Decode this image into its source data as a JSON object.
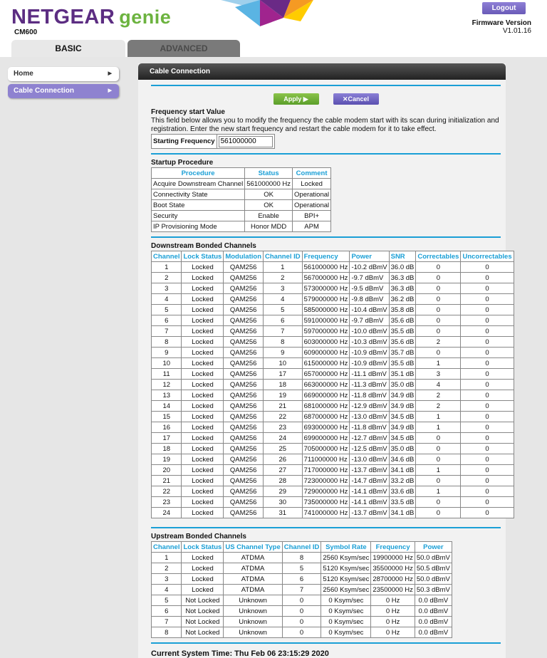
{
  "header": {
    "brand": "NETGEAR",
    "brand_suffix": "genie",
    "model": "CM600",
    "logout": "Logout",
    "firmware_label": "Firmware Version",
    "firmware_value": "V1.01.16"
  },
  "tabs": [
    {
      "label": "BASIC",
      "active": true
    },
    {
      "label": "ADVANCED",
      "active": false
    }
  ],
  "sidebar": {
    "items": [
      {
        "label": "Home"
      },
      {
        "label": "Cable Connection",
        "active": true
      }
    ]
  },
  "panel": {
    "title": "Cable Connection",
    "apply": "Apply ▶",
    "cancel": "✕Cancel"
  },
  "freq": {
    "title": "Frequency start Value",
    "desc": "This field below allows you to modify the frequency the cable modem start with its scan during initialization and registration. Enter the new start frequency and restart the cable modem for it to take effect.",
    "label": "Starting Frequency",
    "value": "561000000"
  },
  "startup": {
    "title": "Startup Procedure",
    "headers": [
      "Procedure",
      "Status",
      "Comment"
    ],
    "rows": [
      [
        "Acquire Downstream Channel",
        "561000000 Hz",
        "Locked"
      ],
      [
        "Connectivity State",
        "OK",
        "Operational"
      ],
      [
        "Boot State",
        "OK",
        "Operational"
      ],
      [
        "Security",
        "Enable",
        "BPI+"
      ],
      [
        "IP Provisioning Mode",
        "Honor MDD",
        "APM"
      ]
    ]
  },
  "downstream": {
    "title": "Downstream Bonded Channels",
    "headers": [
      "Channel",
      "Lock Status",
      "Modulation",
      "Channel ID",
      "Frequency",
      "Power",
      "SNR",
      "Correctables",
      "Uncorrectables"
    ],
    "rows": [
      [
        "1",
        "Locked",
        "QAM256",
        "1",
        "561000000 Hz",
        "-10.2 dBmV",
        "36.0 dB",
        "0",
        "0"
      ],
      [
        "2",
        "Locked",
        "QAM256",
        "2",
        "567000000 Hz",
        "-9.7 dBmV",
        "36.3 dB",
        "0",
        "0"
      ],
      [
        "3",
        "Locked",
        "QAM256",
        "3",
        "573000000 Hz",
        "-9.5 dBmV",
        "36.3 dB",
        "0",
        "0"
      ],
      [
        "4",
        "Locked",
        "QAM256",
        "4",
        "579000000 Hz",
        "-9.8 dBmV",
        "36.2 dB",
        "0",
        "0"
      ],
      [
        "5",
        "Locked",
        "QAM256",
        "5",
        "585000000 Hz",
        "-10.4 dBmV",
        "35.8 dB",
        "0",
        "0"
      ],
      [
        "6",
        "Locked",
        "QAM256",
        "6",
        "591000000 Hz",
        "-9.7 dBmV",
        "35.6 dB",
        "0",
        "0"
      ],
      [
        "7",
        "Locked",
        "QAM256",
        "7",
        "597000000 Hz",
        "-10.0 dBmV",
        "35.5 dB",
        "0",
        "0"
      ],
      [
        "8",
        "Locked",
        "QAM256",
        "8",
        "603000000 Hz",
        "-10.3 dBmV",
        "35.6 dB",
        "2",
        "0"
      ],
      [
        "9",
        "Locked",
        "QAM256",
        "9",
        "609000000 Hz",
        "-10.9 dBmV",
        "35.7 dB",
        "0",
        "0"
      ],
      [
        "10",
        "Locked",
        "QAM256",
        "10",
        "615000000 Hz",
        "-10.9 dBmV",
        "35.5 dB",
        "1",
        "0"
      ],
      [
        "11",
        "Locked",
        "QAM256",
        "17",
        "657000000 Hz",
        "-11.1 dBmV",
        "35.1 dB",
        "3",
        "0"
      ],
      [
        "12",
        "Locked",
        "QAM256",
        "18",
        "663000000 Hz",
        "-11.3 dBmV",
        "35.0 dB",
        "4",
        "0"
      ],
      [
        "13",
        "Locked",
        "QAM256",
        "19",
        "669000000 Hz",
        "-11.8 dBmV",
        "34.9 dB",
        "2",
        "0"
      ],
      [
        "14",
        "Locked",
        "QAM256",
        "21",
        "681000000 Hz",
        "-12.9 dBmV",
        "34.9 dB",
        "2",
        "0"
      ],
      [
        "15",
        "Locked",
        "QAM256",
        "22",
        "687000000 Hz",
        "-13.0 dBmV",
        "34.5 dB",
        "1",
        "0"
      ],
      [
        "16",
        "Locked",
        "QAM256",
        "23",
        "693000000 Hz",
        "-11.8 dBmV",
        "34.9 dB",
        "1",
        "0"
      ],
      [
        "17",
        "Locked",
        "QAM256",
        "24",
        "699000000 Hz",
        "-12.7 dBmV",
        "34.5 dB",
        "0",
        "0"
      ],
      [
        "18",
        "Locked",
        "QAM256",
        "25",
        "705000000 Hz",
        "-12.5 dBmV",
        "35.0 dB",
        "0",
        "0"
      ],
      [
        "19",
        "Locked",
        "QAM256",
        "26",
        "711000000 Hz",
        "-13.0 dBmV",
        "34.6 dB",
        "0",
        "0"
      ],
      [
        "20",
        "Locked",
        "QAM256",
        "27",
        "717000000 Hz",
        "-13.7 dBmV",
        "34.1 dB",
        "1",
        "0"
      ],
      [
        "21",
        "Locked",
        "QAM256",
        "28",
        "723000000 Hz",
        "-14.7 dBmV",
        "33.2 dB",
        "0",
        "0"
      ],
      [
        "22",
        "Locked",
        "QAM256",
        "29",
        "729000000 Hz",
        "-14.1 dBmV",
        "33.6 dB",
        "1",
        "0"
      ],
      [
        "23",
        "Locked",
        "QAM256",
        "30",
        "735000000 Hz",
        "-14.1 dBmV",
        "33.5 dB",
        "0",
        "0"
      ],
      [
        "24",
        "Locked",
        "QAM256",
        "31",
        "741000000 Hz",
        "-13.7 dBmV",
        "34.1 dB",
        "0",
        "0"
      ]
    ]
  },
  "upstream": {
    "title": "Upstream Bonded Channels",
    "headers": [
      "Channel",
      "Lock Status",
      "US Channel Type",
      "Channel ID",
      "Symbol Rate",
      "Frequency",
      "Power"
    ],
    "rows": [
      [
        "1",
        "Locked",
        "ATDMA",
        "8",
        "2560 Ksym/sec",
        "19900000 Hz",
        "50.0 dBmV"
      ],
      [
        "2",
        "Locked",
        "ATDMA",
        "5",
        "5120 Ksym/sec",
        "35500000 Hz",
        "50.5 dBmV"
      ],
      [
        "3",
        "Locked",
        "ATDMA",
        "6",
        "5120 Ksym/sec",
        "28700000 Hz",
        "50.0 dBmV"
      ],
      [
        "4",
        "Locked",
        "ATDMA",
        "7",
        "2560 Ksym/sec",
        "23500000 Hz",
        "50.3 dBmV"
      ],
      [
        "5",
        "Not Locked",
        "Unknown",
        "0",
        "0 Ksym/sec",
        "0 Hz",
        "0.0 dBmV"
      ],
      [
        "6",
        "Not Locked",
        "Unknown",
        "0",
        "0 Ksym/sec",
        "0 Hz",
        "0.0 dBmV"
      ],
      [
        "7",
        "Not Locked",
        "Unknown",
        "0",
        "0 Ksym/sec",
        "0 Hz",
        "0.0 dBmV"
      ],
      [
        "8",
        "Not Locked",
        "Unknown",
        "0",
        "0 Ksym/sec",
        "0 Hz",
        "0.0 dBmV"
      ]
    ]
  },
  "system_time": "Current System Time: Thu Feb 06 23:15:29 2020",
  "colors": {
    "accent": "#1a9fd6",
    "brand_purple": "#5c2d82",
    "brand_green": "#6cb33f",
    "apply": "#6aab34",
    "cancel": "#6a5bb8"
  }
}
